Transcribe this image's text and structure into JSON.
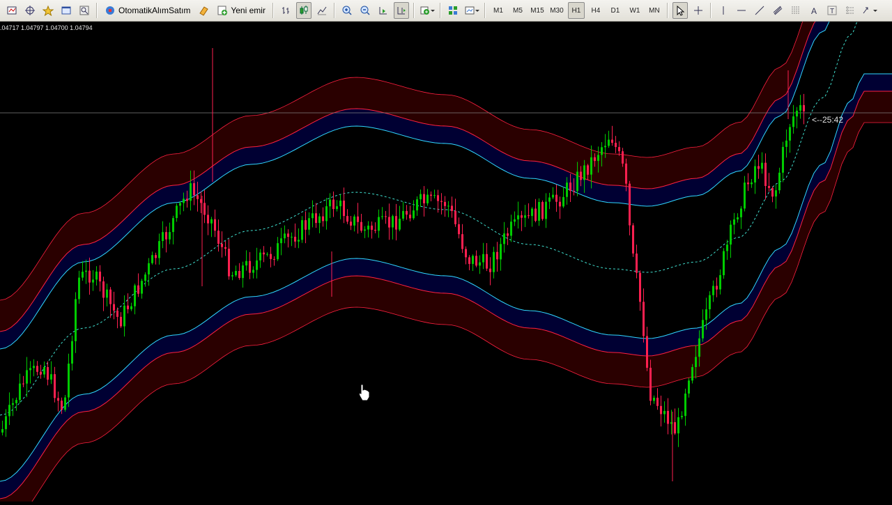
{
  "toolbar": {
    "autotrade_label": "OtomatikAlımSatım",
    "new_order_label": "Yeni emir",
    "timeframes": [
      "M1",
      "M5",
      "M15",
      "M30",
      "H1",
      "H4",
      "D1",
      "W1",
      "MN"
    ],
    "active_timeframe": "H1"
  },
  "chart": {
    "ohlc_text": ".04717 1.04797 1.04700 1.04794",
    "timer_text": "<--25:42",
    "colors": {
      "background": "#000000",
      "outer_band_fill": "#2a0000",
      "inner_band_fill": "#000033",
      "outer_line": "#ff2040",
      "inner_line": "#30d8ff",
      "midline": "#40e0d0",
      "bull_candle": "#00cc00",
      "bear_candle": "#ff2050",
      "price_line": "#808080"
    }
  }
}
